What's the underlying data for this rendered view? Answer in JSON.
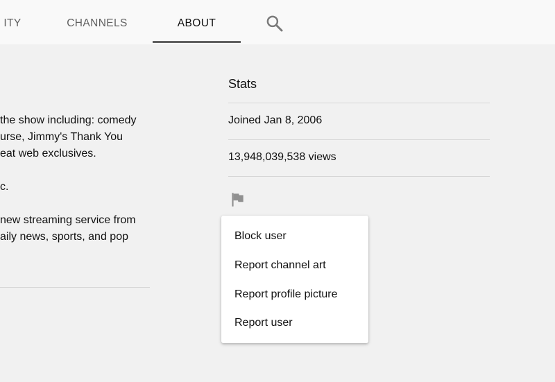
{
  "tabs": {
    "community": "ITY",
    "channels": "CHANNELS",
    "about": "ABOUT"
  },
  "description": {
    "lines": [
      "the show including: comedy",
      "urse, Jimmy's Thank You",
      "eat web exclusives.",
      "c.",
      "new streaming service from",
      "aily news, sports, and pop"
    ]
  },
  "stats": {
    "title": "Stats",
    "joined": "Joined Jan 8, 2006",
    "views": "13,948,039,538 views"
  },
  "icons": {
    "search": "search-icon",
    "flag": "flag-icon"
  },
  "menu": {
    "items": [
      "Block user",
      "Report channel art",
      "Report profile picture",
      "Report user"
    ]
  },
  "colors": {
    "page_background": "#f1f1f1",
    "tabbar_background": "#f9f9f9",
    "active_tab_text": "#0f0f0f",
    "inactive_tab_text": "#606060",
    "icon": "#909090"
  }
}
